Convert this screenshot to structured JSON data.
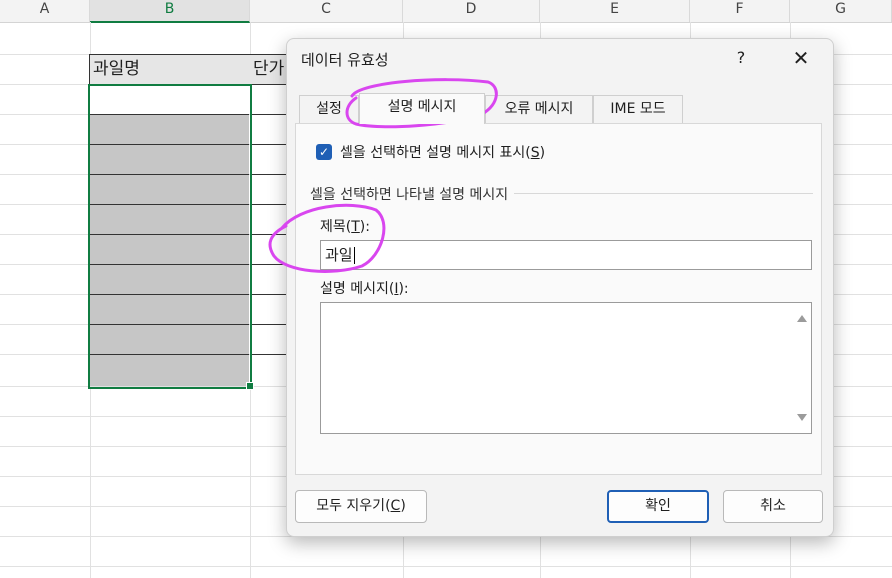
{
  "sheet": {
    "columns": [
      "A",
      "B",
      "C",
      "D",
      "E",
      "F",
      "G"
    ],
    "header_cell": "과일명",
    "header_cell_next": "단가"
  },
  "dialog": {
    "title": "데이터 유효성",
    "help": "?",
    "close": "✕",
    "tabs": [
      {
        "label": "설정"
      },
      {
        "label": "설명 메시지",
        "active": true
      },
      {
        "label": "오류 메시지"
      },
      {
        "label": "IME 모드"
      }
    ],
    "show_message_checkbox": {
      "checked": true,
      "label": "셀을 선택하면 설명 메시지 표시",
      "key": "S"
    },
    "group_label": "셀을 선택하면 나타낼 설명 메시지",
    "title_field": {
      "label": "제목",
      "key": "T",
      "value": "과일"
    },
    "message_field": {
      "label": "설명 메시지",
      "key": "I",
      "value": ""
    },
    "buttons": {
      "clear": "모두 지우기",
      "clear_key": "C",
      "ok": "확인",
      "cancel": "취소"
    }
  },
  "colors": {
    "accent": "#1f5fb5",
    "selection": "#107c41",
    "annotation": "#d946ef"
  }
}
